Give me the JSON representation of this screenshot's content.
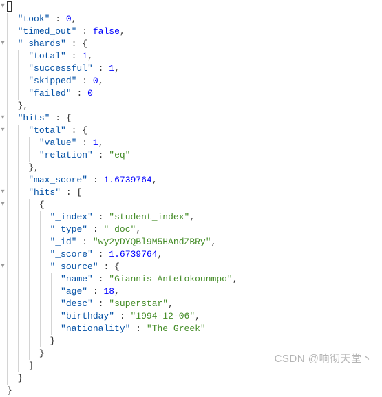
{
  "json": {
    "took": {
      "key": "\"took\"",
      "value": "0"
    },
    "timed_out": {
      "key": "\"timed_out\"",
      "value": "false"
    },
    "shards": {
      "key": "\"_shards\"",
      "total": {
        "key": "\"total\"",
        "value": "1"
      },
      "successful": {
        "key": "\"successful\"",
        "value": "1"
      },
      "skipped": {
        "key": "\"skipped\"",
        "value": "0"
      },
      "failed": {
        "key": "\"failed\"",
        "value": "0"
      }
    },
    "hits": {
      "key": "\"hits\"",
      "total": {
        "key": "\"total\"",
        "value": {
          "key": "\"value\"",
          "value": "1"
        },
        "relation": {
          "key": "\"relation\"",
          "value": "\"eq\""
        }
      },
      "max_score": {
        "key": "\"max_score\"",
        "value": "1.6739764"
      },
      "inner_hits": {
        "key": "\"hits\"",
        "item": {
          "index": {
            "key": "\"_index\"",
            "value": "\"student_index\""
          },
          "type": {
            "key": "\"_type\"",
            "value": "\"_doc\""
          },
          "id": {
            "key": "\"_id\"",
            "value": "\"wy2yDYQBl9M5HAndZBRy\""
          },
          "score": {
            "key": "\"_score\"",
            "value": "1.6739764"
          },
          "source": {
            "key": "\"_source\"",
            "name": {
              "key": "\"name\"",
              "value": "\"Giannis Antetokounmpo\""
            },
            "age": {
              "key": "\"age\"",
              "value": "18"
            },
            "desc": {
              "key": "\"desc\"",
              "value": "\"superstar\""
            },
            "birthday": {
              "key": "\"birthday\"",
              "value": "\"1994-12-06\""
            },
            "nationality": {
              "key": "\"nationality\"",
              "value": "\"The Greek\""
            }
          }
        }
      }
    }
  },
  "watermark": "CSDN @响彻天堂丶"
}
